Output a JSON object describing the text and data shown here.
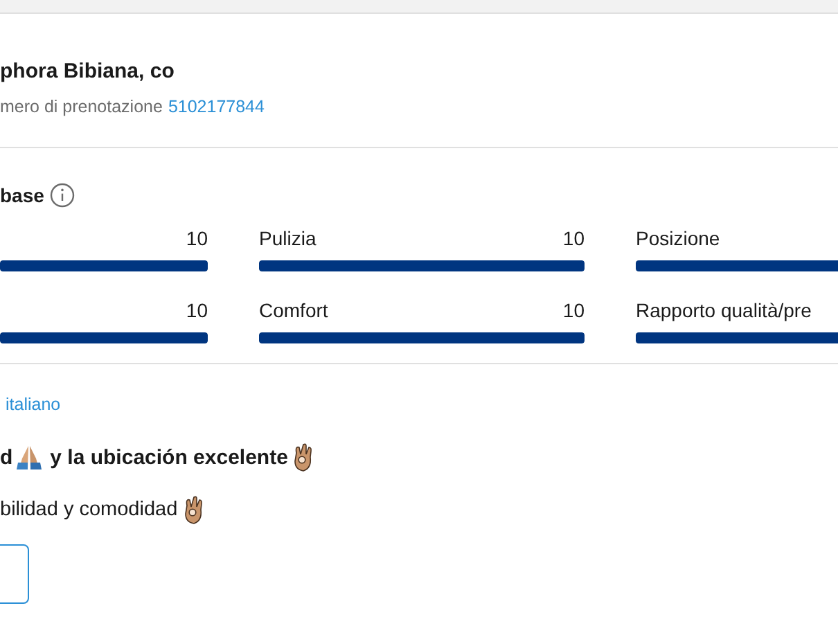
{
  "guest": {
    "name": "phora Bibiana, co",
    "booking_label": "mero di prenotazione",
    "booking_number": "5102177844"
  },
  "ratings_section": {
    "title": "base"
  },
  "ratings": [
    {
      "value": "10",
      "level": 1
    },
    {
      "label": "Pulizia",
      "value": "10",
      "level": 1
    },
    {
      "label": "Posizione"
    },
    {
      "value": "10",
      "level": 1
    },
    {
      "label": "Comfort",
      "value": "10",
      "level": 1
    },
    {
      "label": "Rapporto qualità/pre"
    }
  ],
  "review": {
    "translate_link": "italiano",
    "title_start": "d",
    "title_end": "y la ubicación excelente",
    "body": "bilidad y comodidad"
  }
}
